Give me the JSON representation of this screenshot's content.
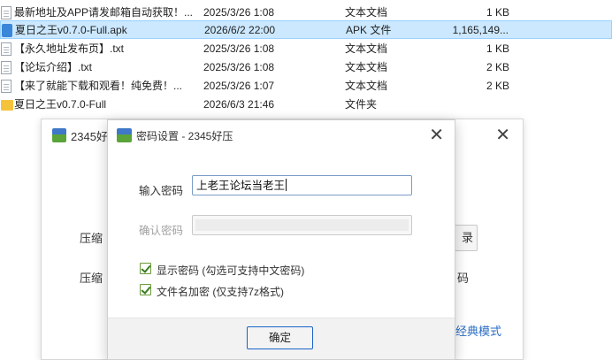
{
  "files": [
    {
      "name": "最新地址及APP请发邮箱自动获取！...",
      "date": "2025/3/26 1:08",
      "type": "文本文档",
      "size": "1 KB",
      "icon": "text-file-icon",
      "selected": false
    },
    {
      "name": "夏日之王v0.7.0-Full.apk",
      "date": "2026/6/2 22:00",
      "type": "APK 文件",
      "size": "1,165,149...",
      "icon": "apk-file-icon",
      "selected": true
    },
    {
      "name": "【永久地址发布页】.txt",
      "date": "2025/3/26 1:08",
      "type": "文本文档",
      "size": "1 KB",
      "icon": "text-file-icon",
      "selected": false
    },
    {
      "name": "【论坛介绍】.txt",
      "date": "2025/3/26 1:08",
      "type": "文本文档",
      "size": "2 KB",
      "icon": "text-file-icon",
      "selected": false
    },
    {
      "name": "【来了就能下载和观看！纯免费！...",
      "date": "2025/3/26 1:07",
      "type": "文本文档",
      "size": "2 KB",
      "icon": "text-file-icon",
      "selected": false
    },
    {
      "name": "夏日之王v0.7.0-Full",
      "date": "2026/6/3 21:46",
      "type": "文件夹",
      "size": "",
      "icon": "folder-icon",
      "selected": false
    }
  ],
  "bg_window": {
    "title": "2345好",
    "label1": "压缩",
    "label2": "压缩",
    "btn_text": "录",
    "side_text": "码",
    "link_text": "经典模式"
  },
  "dialog": {
    "title": "密码设置 - 2345好压",
    "password_label": "输入密码",
    "password_value": "上老王论坛当老王",
    "confirm_label": "确认密码",
    "confirm_value": "",
    "show_password_label": "显示密码 (勾选可支持中文密码)",
    "show_password_checked": true,
    "encrypt_filenames_label": "文件名加密 (仅支持7z格式)",
    "encrypt_filenames_checked": true,
    "ok_label": "确定"
  },
  "colors": {
    "selection": "#cce8ff",
    "accent": "#1b63c9",
    "link": "#2a6cc4"
  }
}
